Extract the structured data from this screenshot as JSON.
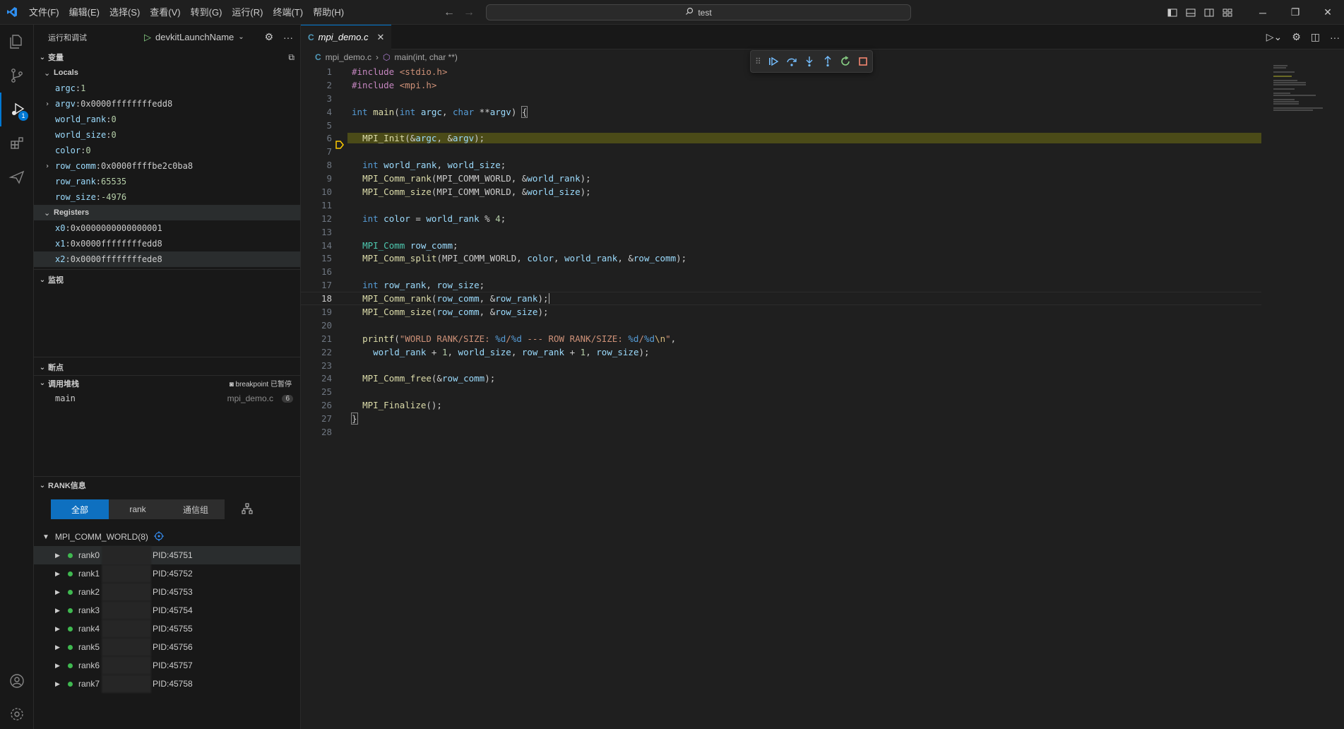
{
  "titlebar": {
    "menus": [
      "文件(F)",
      "编辑(E)",
      "选择(S)",
      "查看(V)",
      "转到(G)",
      "运行(R)",
      "终端(T)",
      "帮助(H)"
    ],
    "search": "test",
    "accent": "#0078d4"
  },
  "activity": {
    "debug_badge": "1",
    "icons": [
      "explorer-icon",
      "source-control-icon",
      "run-debug-icon",
      "extensions-icon",
      "send-icon",
      "account-icon",
      "settings-gear-icon"
    ]
  },
  "sidebar": {
    "title": "运行和调试",
    "config_name": "devkitLaunchName",
    "variables": {
      "title": "变量",
      "locals_label": "Locals",
      "locals": [
        {
          "name": "argc",
          "value": "1"
        },
        {
          "name": "argv",
          "value": "0x0000ffffffffedd8"
        },
        {
          "name": "world_rank",
          "value": "0"
        },
        {
          "name": "world_size",
          "value": "0"
        },
        {
          "name": "color",
          "value": "0"
        },
        {
          "name": "row_comm",
          "value": "0x0000ffffbe2c0ba8"
        },
        {
          "name": "row_rank",
          "value": "65535"
        },
        {
          "name": "row_size",
          "value": "-4976"
        }
      ],
      "registers_label": "Registers",
      "registers": [
        {
          "name": "x0",
          "value": "0x0000000000000001"
        },
        {
          "name": "x1",
          "value": "0x0000ffffffffedd8"
        },
        {
          "name": "x2",
          "value": "0x0000ffffffffede8"
        }
      ]
    },
    "watch_title": "监视",
    "breakpoints_title": "断点",
    "callstack": {
      "title": "调用堆栈",
      "status": "breakpoint 已暂停",
      "frame_name": "main",
      "frame_file": "mpi_demo.c",
      "frame_line": "6"
    },
    "rank": {
      "title": "RANK信息",
      "tabs": [
        "全部",
        "rank",
        "通信组"
      ],
      "group": "MPI_COMM_WORLD(8)",
      "ranks": [
        {
          "name": "rank0",
          "pid": "PID:45751"
        },
        {
          "name": "rank1",
          "pid": "PID:45752"
        },
        {
          "name": "rank2",
          "pid": "PID:45753"
        },
        {
          "name": "rank3",
          "pid": "PID:45754"
        },
        {
          "name": "rank4",
          "pid": "PID:45755"
        },
        {
          "name": "rank5",
          "pid": "PID:45756"
        },
        {
          "name": "rank6",
          "pid": "PID:45757"
        },
        {
          "name": "rank7",
          "pid": "PID:45758"
        }
      ]
    }
  },
  "editor": {
    "tab_label": "mpi_demo.c",
    "breadcrumb_file": "mpi_demo.c",
    "breadcrumb_symbol": "main(int, char **)",
    "current_line": "18",
    "paused_line": "6",
    "lines": [
      "1",
      "2",
      "3",
      "4",
      "5",
      "6",
      "7",
      "8",
      "9",
      "10",
      "11",
      "12",
      "13",
      "14",
      "15",
      "16",
      "17",
      "18",
      "19",
      "20",
      "21",
      "22",
      "23",
      "24",
      "25",
      "26",
      "27",
      "28"
    ]
  }
}
